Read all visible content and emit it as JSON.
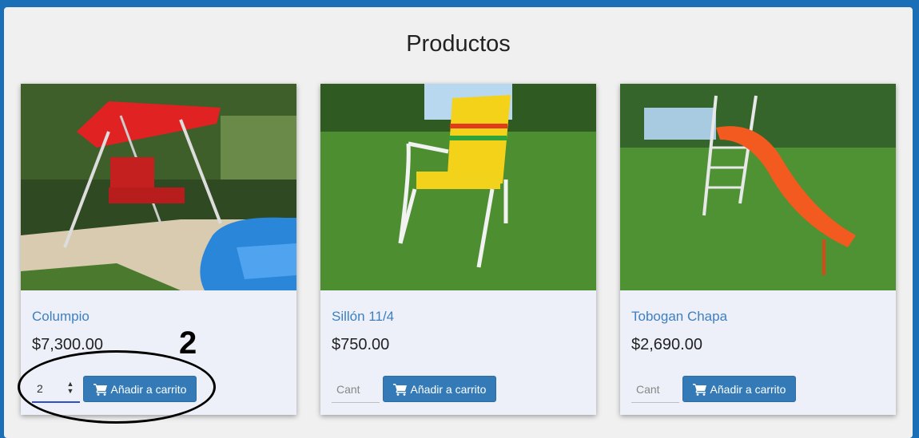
{
  "page": {
    "title": "Productos"
  },
  "products": [
    {
      "name": "Columpio",
      "price": "$7,300.00",
      "qty_value": "2",
      "qty_placeholder": "Cant",
      "button_label": "Añadir a carrito"
    },
    {
      "name": "Sillón 11/4",
      "price": "$750.00",
      "qty_value": "",
      "qty_placeholder": "Cant",
      "button_label": "Añadir a carrito"
    },
    {
      "name": "Tobogan Chapa",
      "price": "$2,690.00",
      "qty_value": "",
      "qty_placeholder": "Cant",
      "button_label": "Añadir a carrito"
    }
  ],
  "annotation": {
    "label": "2"
  },
  "colors": {
    "frame": "#1b6fb6",
    "button": "#337ab7",
    "link": "#3d7fc1",
    "card": "#eef0f9"
  },
  "icons": {
    "cart": "shopping-cart-icon",
    "spinner": "number-spinner-icon"
  }
}
